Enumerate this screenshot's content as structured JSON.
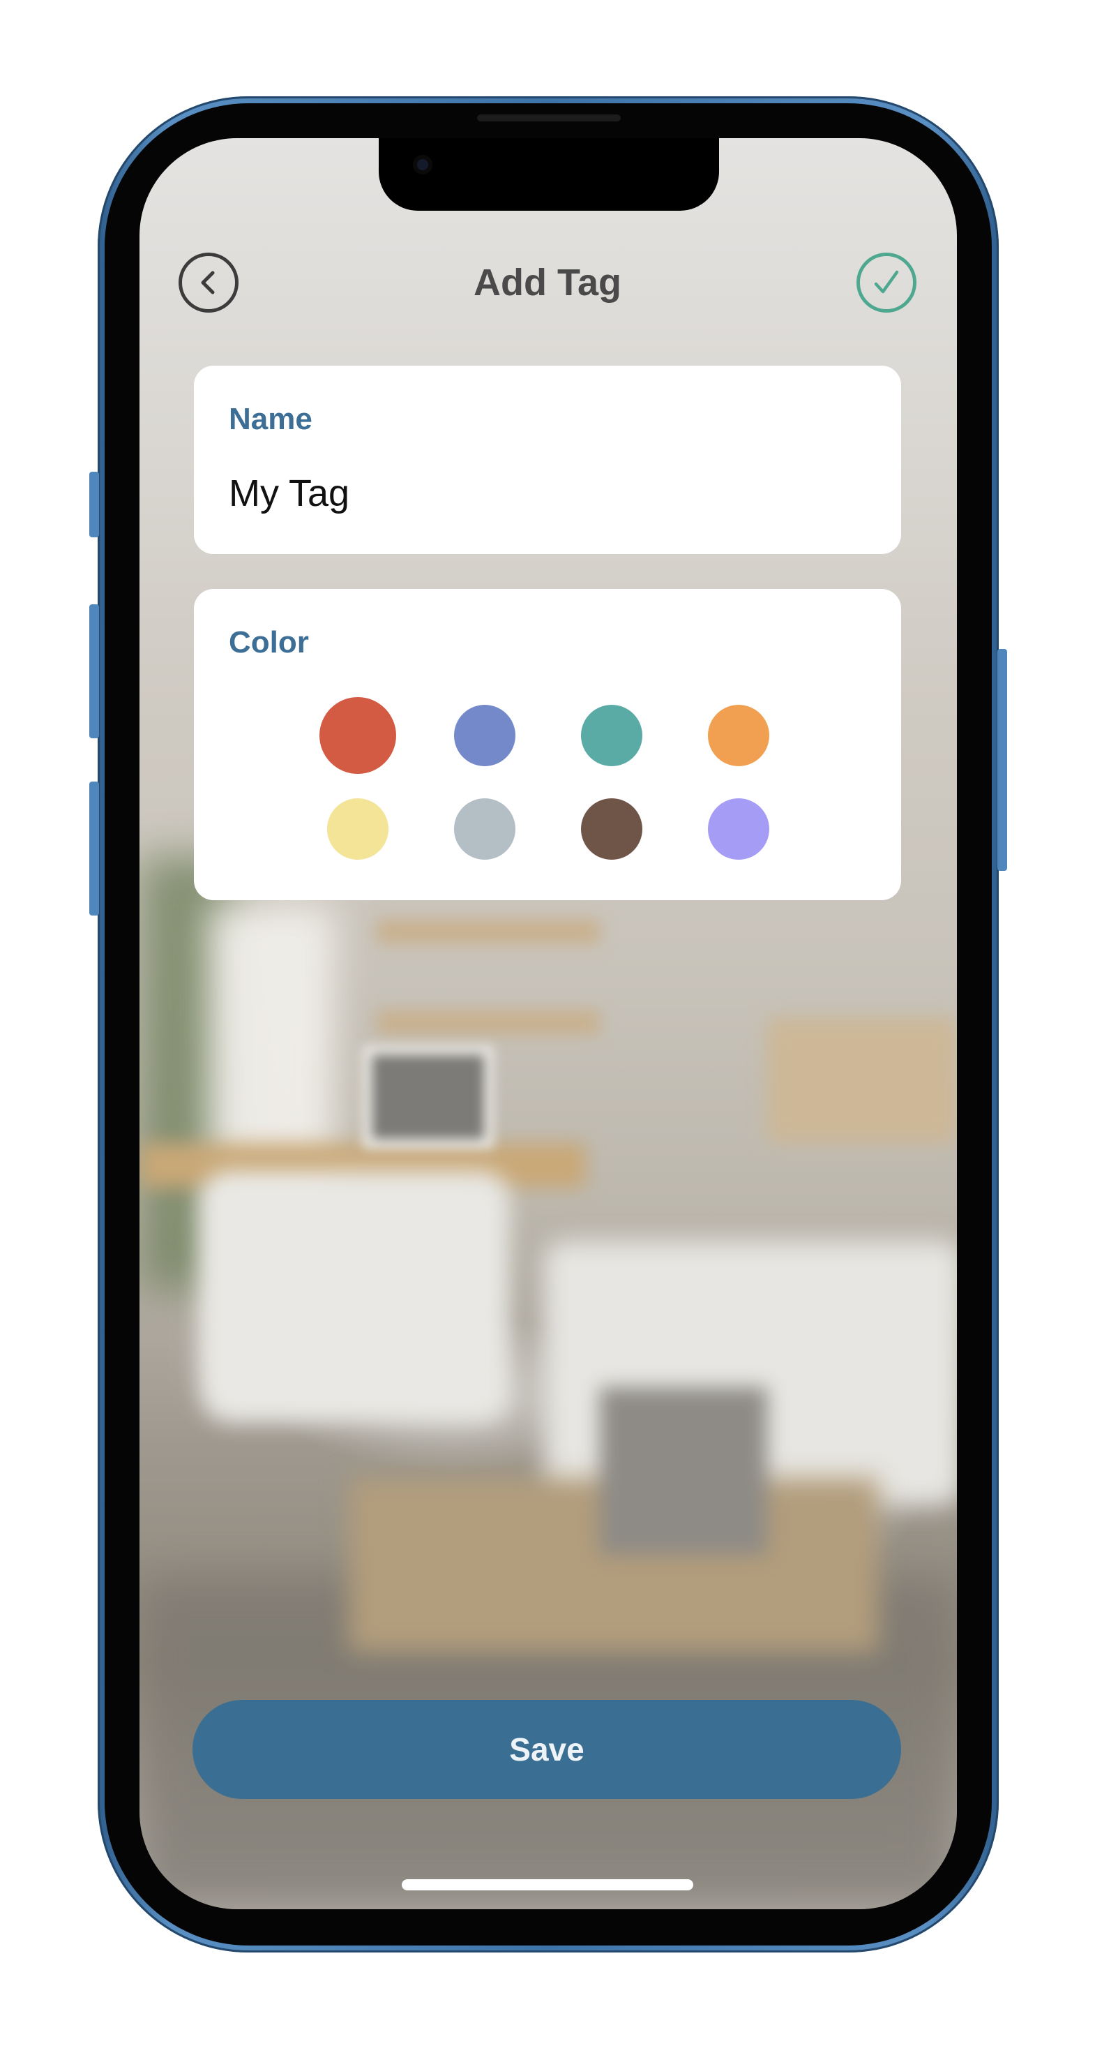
{
  "header": {
    "title": "Add Tag",
    "back_icon": "chevron-left-icon",
    "confirm_icon": "checkmark-icon"
  },
  "name_card": {
    "label": "Name",
    "value": "My Tag"
  },
  "color_card": {
    "label": "Color",
    "selected_index": 0,
    "swatches": [
      {
        "color": "#d45b43"
      },
      {
        "color": "#7489c9"
      },
      {
        "color": "#5aaaa6"
      },
      {
        "color": "#f0a050"
      },
      {
        "color": "#f3e497"
      },
      {
        "color": "#b4bec5"
      },
      {
        "color": "#6f5448"
      },
      {
        "color": "#a59cf5"
      }
    ]
  },
  "save_button": {
    "label": "Save"
  },
  "colors": {
    "accent": "#3a6f93",
    "confirm": "#4ea88f",
    "label": "#3d6f96"
  }
}
